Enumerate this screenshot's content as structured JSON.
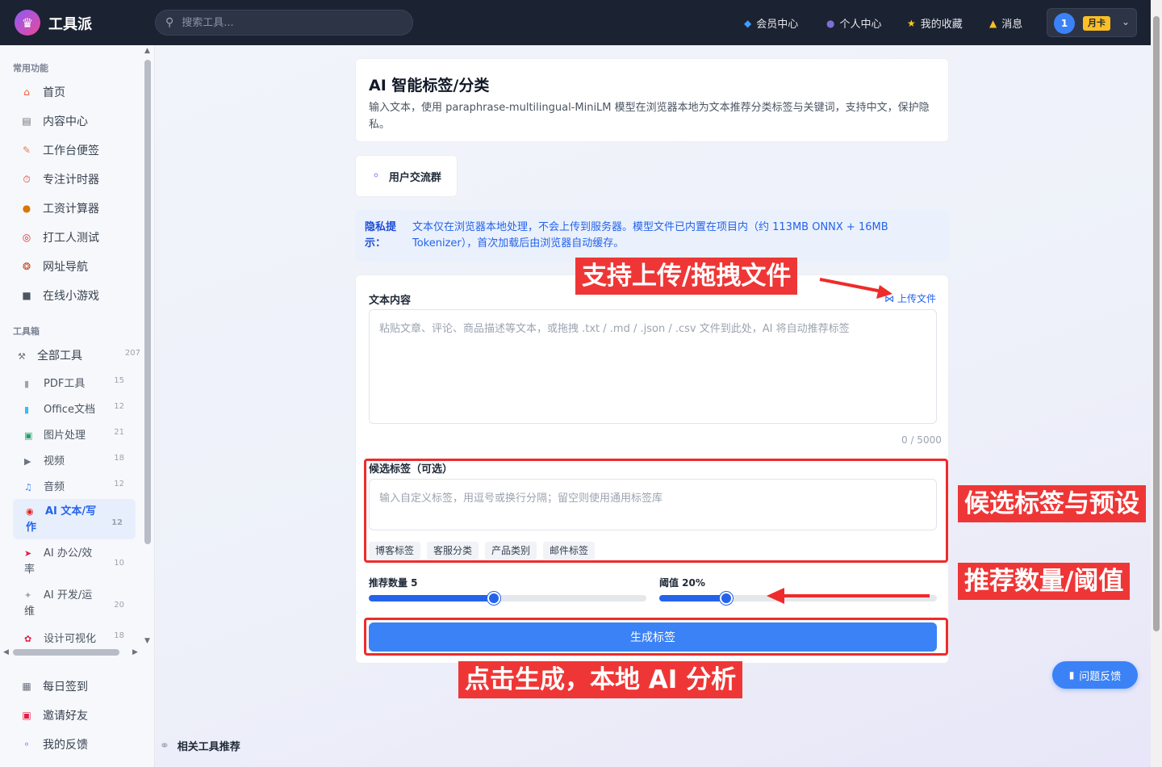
{
  "header": {
    "brand": "工具派",
    "search_placeholder": "搜索工具...",
    "nav": [
      {
        "label": "会员中心",
        "icon": "diamond-icon"
      },
      {
        "label": "个人中心",
        "icon": "user-icon"
      },
      {
        "label": "我的收藏",
        "icon": "star-icon"
      },
      {
        "label": "消息",
        "icon": "bell-icon"
      }
    ],
    "user": {
      "avatar": "1",
      "badge": "月卡"
    }
  },
  "sidebar": {
    "common_label": "常用功能",
    "common": [
      {
        "label": "首页",
        "icon": "home-icon"
      },
      {
        "label": "内容中心",
        "icon": "news-icon"
      },
      {
        "label": "工作台便签",
        "icon": "memo-icon"
      },
      {
        "label": "专注计时器",
        "icon": "timer-icon"
      },
      {
        "label": "工资计算器",
        "icon": "money-bag-icon"
      },
      {
        "label": "打工人测试",
        "icon": "target-icon"
      },
      {
        "label": "网址导航",
        "icon": "compass-icon"
      },
      {
        "label": "在线小游戏",
        "icon": "gamepad-icon"
      }
    ],
    "toolbox_label": "工具箱",
    "all_tools": {
      "label": "全部工具",
      "count": "207"
    },
    "tools": [
      {
        "label": "PDF工具",
        "count": "15",
        "icon": "pdf-icon"
      },
      {
        "label": "Office文档",
        "count": "12",
        "icon": "office-icon"
      },
      {
        "label": "图片处理",
        "count": "21",
        "icon": "image-icon"
      },
      {
        "label": "视频",
        "count": "18",
        "icon": "video-icon"
      },
      {
        "label": "音频",
        "count": "12",
        "icon": "music-icon"
      },
      {
        "label_line1": "AI 文本/写",
        "label_line2": "作",
        "count": "12",
        "icon": "robot-icon"
      },
      {
        "label_line1": "AI 办公/效",
        "label_line2": "率",
        "count": "10",
        "icon": "rocket-icon"
      },
      {
        "label_line1": "AI 开发/运",
        "label_line2": "维",
        "count": "20",
        "icon": "wrench-icon"
      },
      {
        "label": "设计可视化",
        "count": "18",
        "icon": "palette-icon"
      }
    ],
    "bottom": [
      {
        "label": "每日签到",
        "icon": "calendar-icon"
      },
      {
        "label": "邀请好友",
        "icon": "gift-icon"
      },
      {
        "label": "我的反馈",
        "icon": "speech-icon"
      }
    ]
  },
  "main": {
    "title": "AI 智能标签/分类",
    "description": "输入文本，使用 paraphrase-multilingual-MiniLM 模型在浏览器本地为文本推荐分类标签与关键词，支持中文，保护隐私。",
    "group_button": "用户交流群",
    "privacy_label": "隐私提示：",
    "privacy_text": "文本仅在浏览器本地处理，不会上传到服务器。模型文件已内置在项目内（约 113MB ONNX + 16MB Tokenizer），首次加载后由浏览器自动缓存。",
    "text_label": "文本内容",
    "upload_label": "上传文件",
    "text_placeholder": "粘贴文章、评论、商品描述等文本，或拖拽 .txt / .md / .json / .csv 文件到此处，AI 将自动推荐标签",
    "counter": "0 / 5000",
    "candidate_label": "候选标签（可选）",
    "candidate_placeholder": "输入自定义标签，用逗号或换行分隔；留空则使用通用标签库",
    "presets": [
      "博客标签",
      "客服分类",
      "产品类别",
      "邮件标签"
    ],
    "count_label": "推荐数量 5",
    "count_fraction": 0.45,
    "threshold_label": "阈值 20%",
    "threshold_fraction": 0.24,
    "generate_button": "生成标签",
    "related_label": "相关工具推荐",
    "feedback_button": "问题反馈"
  },
  "annotations": {
    "upload": "支持上传/拖拽文件",
    "candidates": "候选标签与预设",
    "sliders": "推荐数量/阈值",
    "generate": "点击生成，本地 AI 分析"
  },
  "colors": {
    "accent": "#3b82f6",
    "annotation": "#ef3636",
    "header": "#1b2232"
  }
}
